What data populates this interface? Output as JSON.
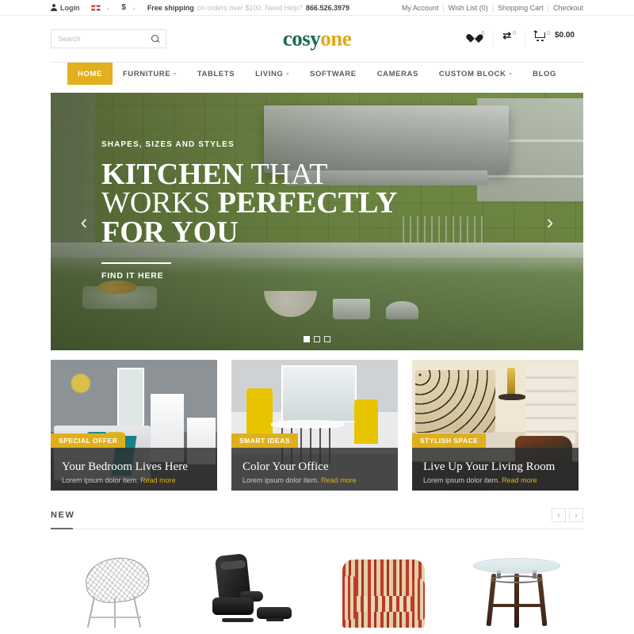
{
  "topbar": {
    "login_label": "Login",
    "login_icon": "person-icon",
    "flag_icon": "flag-icon",
    "language_caret": "⌄",
    "currency_label": "$",
    "currency_caret": "⌄",
    "shipping_strong": "Free shipping",
    "shipping_light": "on orders over $100. Need Help?",
    "phone": "866.526.3979",
    "links": [
      {
        "label": "My Account"
      },
      {
        "label": "Wish List (0)"
      },
      {
        "label": "Shopping Cart"
      },
      {
        "label": "Checkout"
      }
    ],
    "separator": "|"
  },
  "header": {
    "search": {
      "placeholder": "Search",
      "value": "",
      "icon": "search-icon"
    },
    "logo": {
      "part1": "cosy",
      "part2": "one",
      "color1": "#1d6b4f",
      "color2": "#e0a81e"
    },
    "wishlist": {
      "icon": "heart-icon",
      "count": "0"
    },
    "compare": {
      "icon": "compare-icon",
      "count": "0"
    },
    "cart": {
      "icon": "cart-icon",
      "count": "0",
      "total": "$0.00"
    }
  },
  "nav": {
    "items": [
      {
        "label": "HOME",
        "active": true,
        "has_caret": false
      },
      {
        "label": "FURNITURE",
        "active": false,
        "has_caret": true
      },
      {
        "label": "TABLETS",
        "active": false,
        "has_caret": false
      },
      {
        "label": "LIVING",
        "active": false,
        "has_caret": true
      },
      {
        "label": "SOFTWARE",
        "active": false,
        "has_caret": false
      },
      {
        "label": "CAMERAS",
        "active": false,
        "has_caret": false
      },
      {
        "label": "CUSTOM BLOCK",
        "active": false,
        "has_caret": true
      },
      {
        "label": "BLOG",
        "active": false,
        "has_caret": false
      }
    ],
    "caret": "▾",
    "active_color": "#e2b01f"
  },
  "hero": {
    "kicker": "SHAPES, SIZES AND STYLES",
    "line1_bold": "KITCHEN",
    "line1_light": "THAT",
    "line2_light": "WORKS",
    "line2_bold": "PERFECTLY",
    "line3_bold": "FOR YOU",
    "cta": "FIND IT HERE",
    "prev_icon": "chevron-left-icon",
    "next_icon": "chevron-right-icon",
    "prev_glyph": "‹",
    "next_glyph": "›",
    "slides_total": 3,
    "active_slide": 1
  },
  "promos": [
    {
      "badge": "SPECIAL OFFER",
      "title": "Your Bedroom Lives Here",
      "subtitle": "Lorem ipsum dolor item.",
      "readmore": "Read more",
      "image_name": "bedroom-image"
    },
    {
      "badge": "SMART IDEAS",
      "title": "Color Your Office",
      "subtitle": "Lorem ipsum dolor item.",
      "readmore": "Read more",
      "image_name": "office-image"
    },
    {
      "badge": "STYLISH SPACE",
      "title": "Live Up Your Living Room",
      "subtitle": "Lorem ipsum dolor item.",
      "readmore": "Read more",
      "image_name": "living-room-image"
    }
  ],
  "new_section": {
    "title": "NEW",
    "prev_glyph": "‹",
    "next_glyph": "›",
    "products": [
      {
        "image_name": "wire-mesh-chair-image"
      },
      {
        "image_name": "black-recliner-image"
      },
      {
        "image_name": "striped-armchair-image"
      },
      {
        "image_name": "glass-top-table-image"
      }
    ]
  }
}
